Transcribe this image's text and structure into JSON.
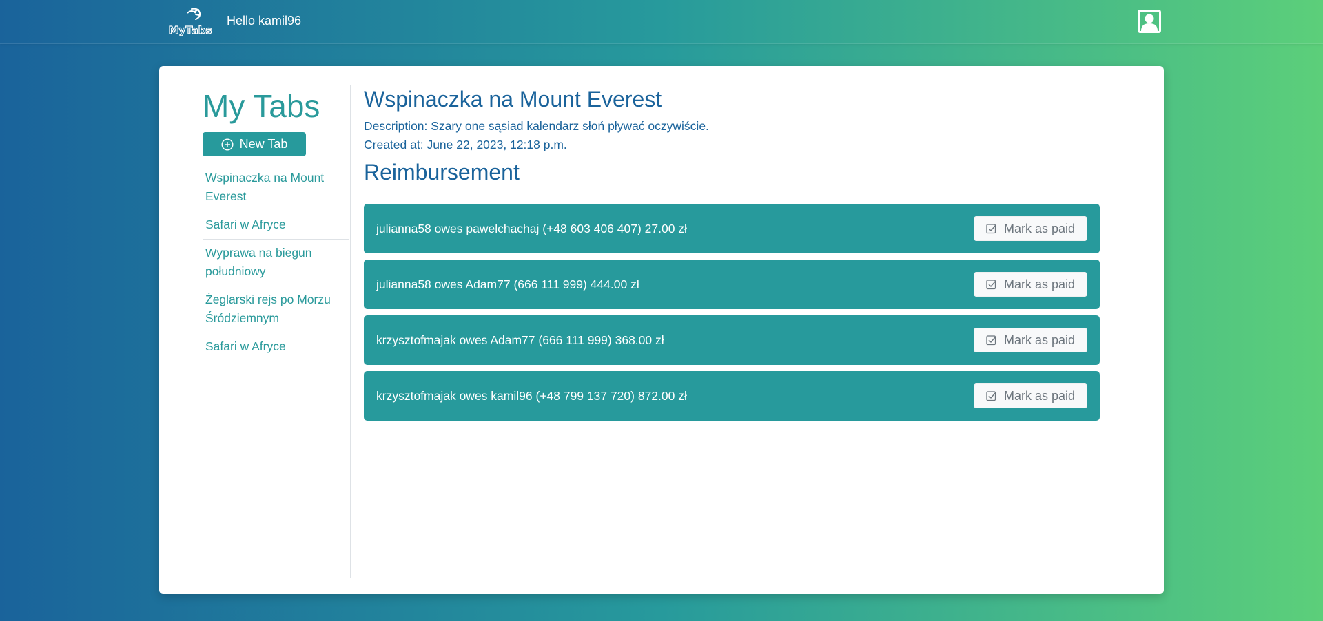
{
  "navbar": {
    "logo_text": "MyTabs",
    "greeting": "Hello kamil96",
    "user_icon": "user-profile-icon"
  },
  "sidebar": {
    "title": "My Tabs",
    "new_tab_label": "New Tab",
    "new_tab_icon": "plus-circle-icon",
    "items": [
      {
        "label": "Wspinaczka na Mount Everest"
      },
      {
        "label": "Safari w Afryce"
      },
      {
        "label": "Wyprawa na biegun południowy"
      },
      {
        "label": "Żeglarski rejs po Morzu Śródziemnym"
      },
      {
        "label": "Safari w Afryce"
      }
    ]
  },
  "main": {
    "title": "Wspinaczka na Mount Everest",
    "description": "Description: Szary one sąsiad kalendarz słoń pływać oczywiście.",
    "created_at": "Created at: June 22, 2023, 12:18 p.m.",
    "section_title": "Reimbursement",
    "reimbursements": [
      {
        "text": "julianna58 owes pawelchachaj (+48 603 406 407) 27.00 zł",
        "button": "Mark as paid"
      },
      {
        "text": "julianna58 owes Adam77 (666 111 999) 444.00 zł",
        "button": "Mark as paid"
      },
      {
        "text": "krzysztofmajak owes Adam77 (666 111 999) 368.00 zł",
        "button": "Mark as paid"
      },
      {
        "text": "krzysztofmajak owes kamil96 (+48 799 137 720) 872.00 zł",
        "button": "Mark as paid"
      }
    ]
  },
  "colors": {
    "accent": "#279a9c",
    "heading": "#1a639b",
    "gradient_start": "#1a639b",
    "gradient_end": "#5ccf7a"
  }
}
